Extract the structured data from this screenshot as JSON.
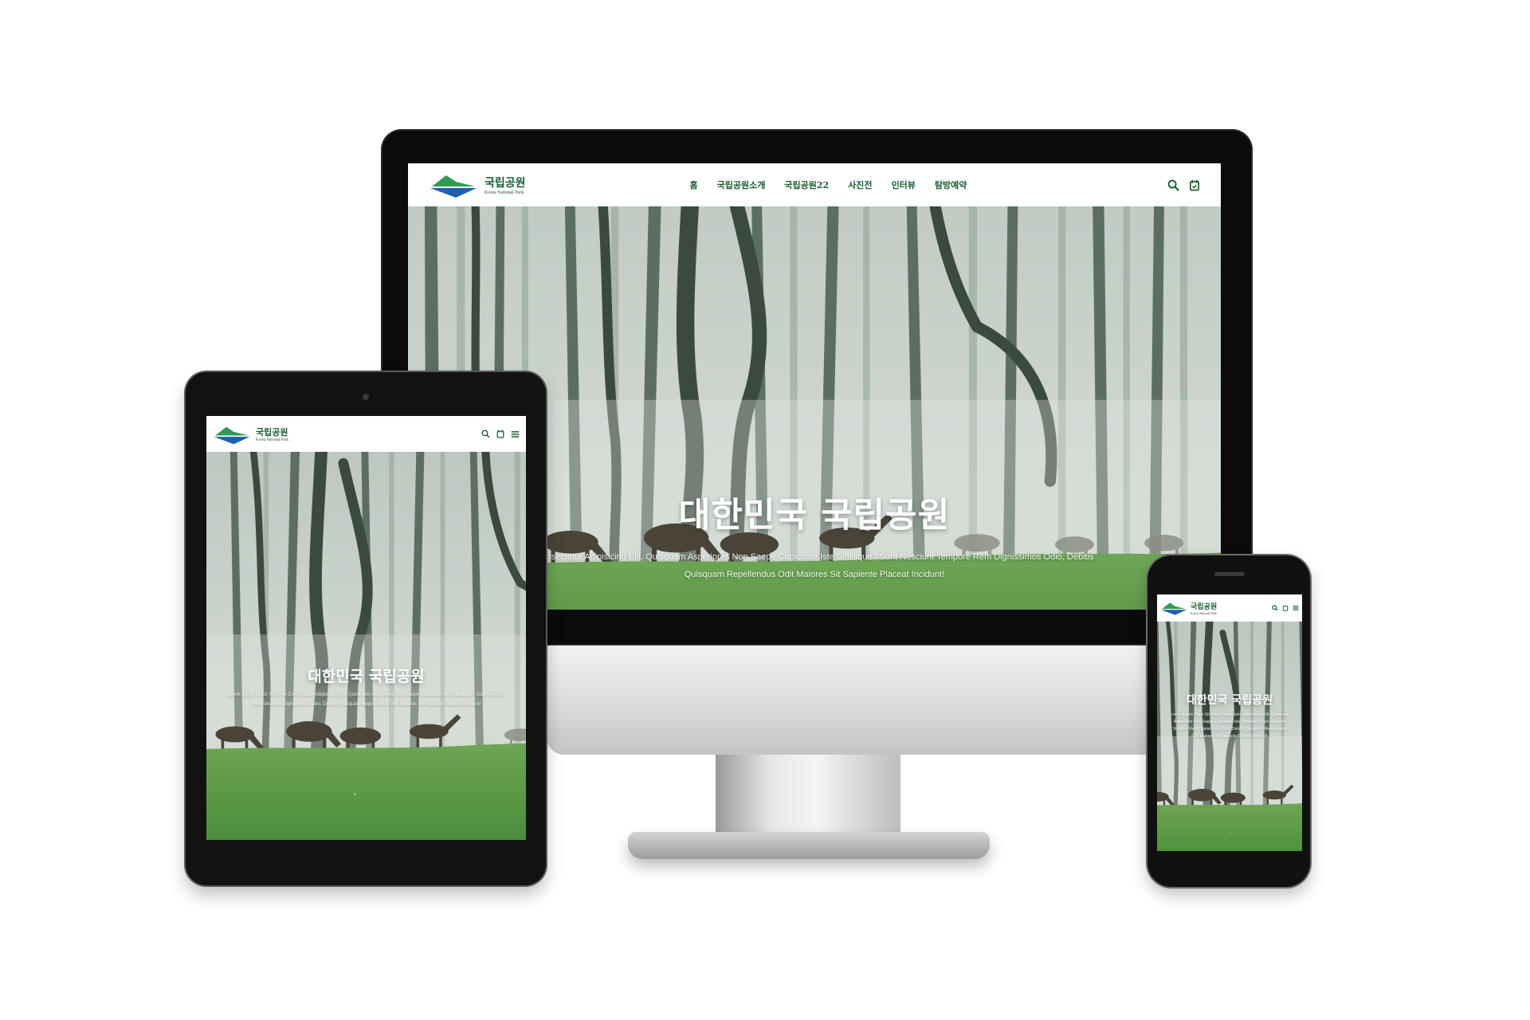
{
  "site": {
    "logo_ko": "국립공원",
    "logo_en": "Korea National Park",
    "nav": [
      "홈",
      "국립공원소개",
      "국립공원22",
      "사진전",
      "인터뷰",
      "탐방예약"
    ],
    "icons": [
      "search-icon",
      "calendar-icon",
      "menu-icon"
    ],
    "hero_title": "대한민국 국립공원"
  },
  "desktop": {
    "hero_desc": "Consectetur Adipisicing Elit. Quisquam Asperiores Non Saepe Cupiditate Iste Similique? Sunt Nesciunt Tempore Rem Dignissimos Odio, Debitis Quisquam Repellendus Odit Maiores Sit Sapiente Placeat Incidunt!"
  },
  "mobile": {
    "hero_desc": "Lorem Ipsum Dolor Sit Amet Consectetur Adipisicing Elit. Quisquam Asperiores Non Saepe Cupiditate Iste Similique? Sunt Nesciunt Tempore Rem Dignissimos Odio, Debitis Quisquam Repellendus Odit Maiores Sit Sapiente Placeat Incidunt!"
  },
  "colors": {
    "brand_green": "#1a5c33",
    "logo_blue": "#1f5fae",
    "logo_green": "#2e9b55",
    "grass": "#4f8f3c",
    "fog": "#c9d2cc"
  }
}
